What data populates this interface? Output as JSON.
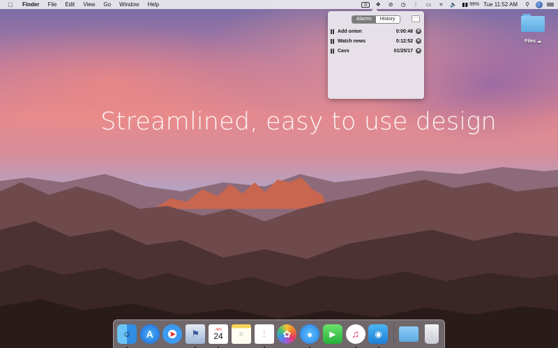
{
  "menubar": {
    "app_name": "Finder",
    "menus": [
      "File",
      "Edit",
      "View",
      "Go",
      "Window",
      "Help"
    ],
    "battery": "99%",
    "time": "Tue 11:52 AM"
  },
  "desktop": {
    "headline": "Streamlined, easy to use design",
    "folder_label": "Files"
  },
  "popover": {
    "tabs": [
      {
        "label": "Alarms",
        "active": true
      },
      {
        "label": "History",
        "active": false
      }
    ],
    "more_label": "···",
    "alarms": [
      {
        "name": "Add onion",
        "time": "0:00:48"
      },
      {
        "name": "Watch news",
        "time": "0:12:52"
      },
      {
        "name": "Cavs",
        "time": "01/25/17"
      }
    ]
  },
  "dock": {
    "calendar_month": "JAN",
    "calendar_day": "24",
    "apps": [
      "finder",
      "app-store",
      "safari",
      "preview",
      "calendar",
      "notes",
      "reminders",
      "photos",
      "messages",
      "facetime",
      "itunes",
      "tweetbot",
      "downloads-folder",
      "trash"
    ]
  },
  "colors": {
    "menubar_bg": "#ecebf0",
    "popover_bg": "#e8e4ec",
    "segment_active": "#7b7b7b",
    "folder_blue": "#5fabe2"
  }
}
